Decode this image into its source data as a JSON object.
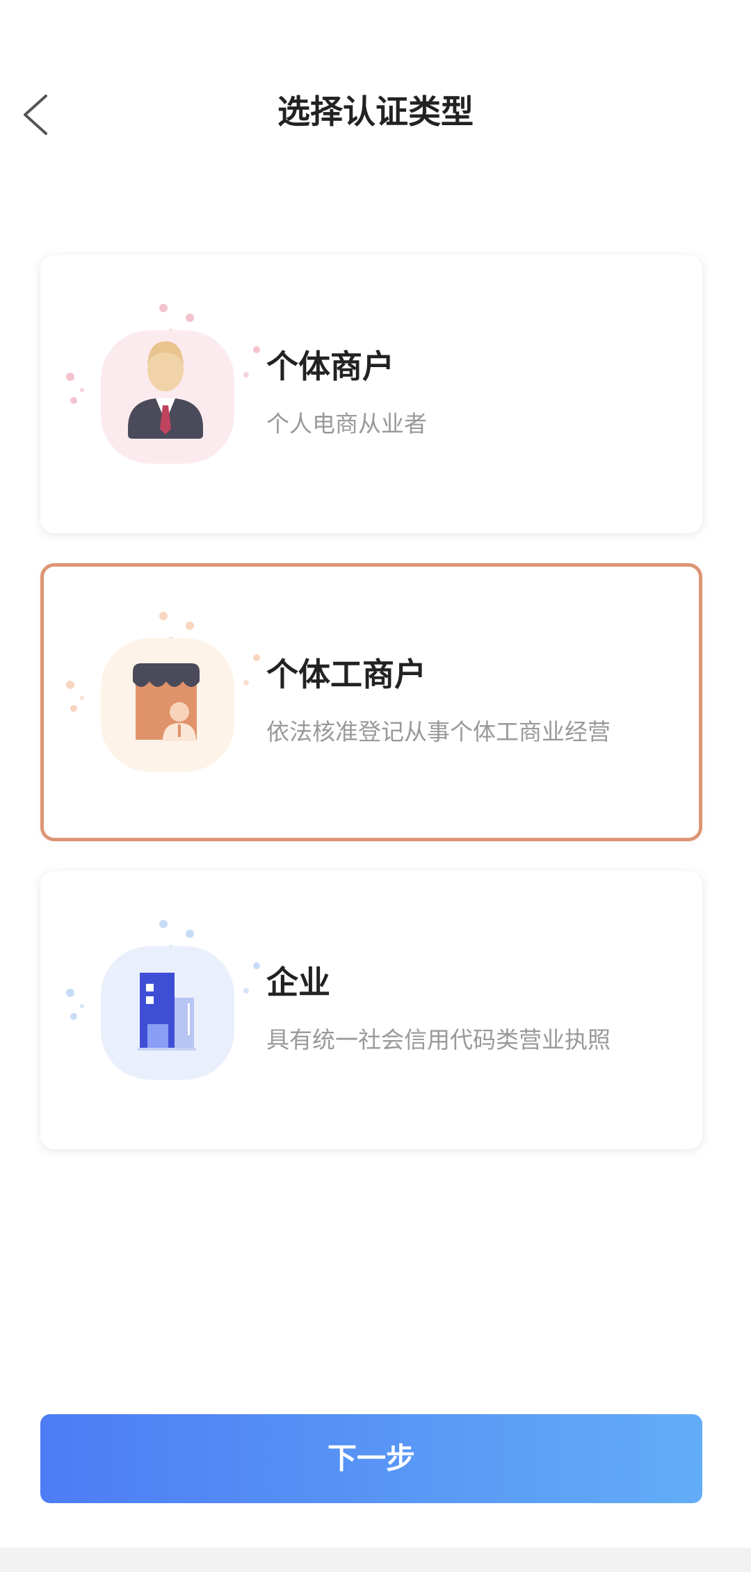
{
  "header": {
    "title": "选择认证类型",
    "back_icon": "chevron-left-icon"
  },
  "cards": [
    {
      "title": "个体商户",
      "desc": "个人电商从业者",
      "icon": "businessman-icon",
      "selected": false
    },
    {
      "title": "个体工商户",
      "desc": "依法核准登记从事个体工商业经营",
      "icon": "storefront-icon",
      "selected": true
    },
    {
      "title": "企业",
      "desc": "具有统一社会信用代码类营业执照",
      "icon": "building-icon",
      "selected": false
    }
  ],
  "next_button": {
    "label": "下一步"
  },
  "colors": {
    "selected_border": "#dc9574",
    "button_gradient_start": "#4d7cf4",
    "button_gradient_end": "#62adf7"
  }
}
